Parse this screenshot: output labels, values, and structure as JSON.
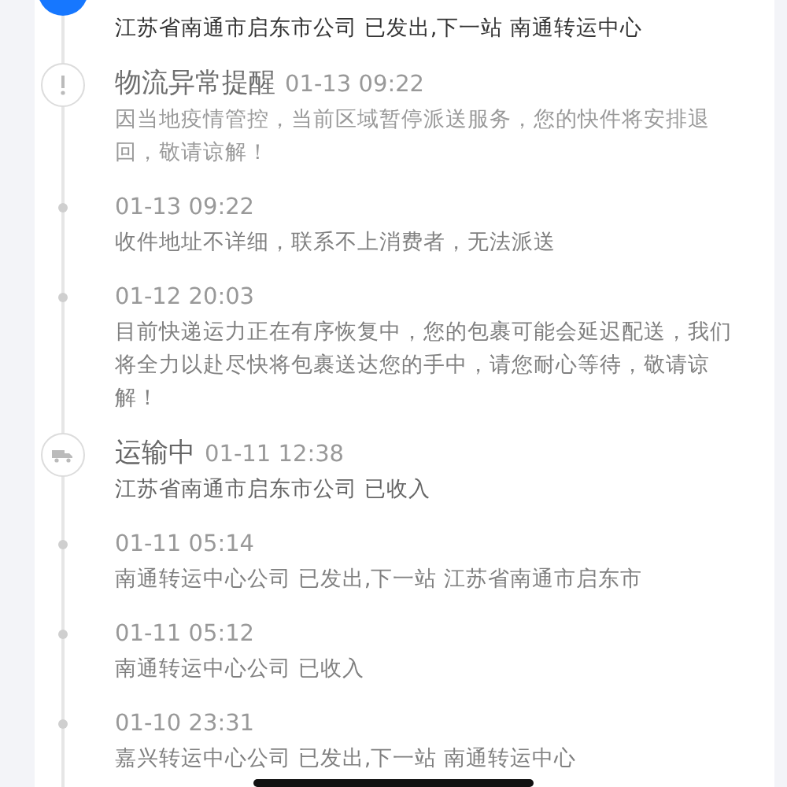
{
  "entries": [
    {
      "kind": "current",
      "body": "江苏省南通市启东市公司 已发出,下一站 南通转运中心"
    },
    {
      "kind": "alert",
      "title": "物流异常提醒",
      "time": "01-13 09:22",
      "body": "因当地疫情管控，当前区域暂停派送服务，您的快件将安排退回，敬请谅解！"
    },
    {
      "kind": "dot",
      "time": "01-13 09:22",
      "body": "收件地址不详细，联系不上消费者，无法派送"
    },
    {
      "kind": "dot",
      "time": "01-12 20:03",
      "body": "目前快递运力正在有序恢复中，您的包裹可能会延迟配送，我们将全力以赴尽快将包裹送达您的手中，请您耐心等待，敬请谅解！"
    },
    {
      "kind": "transit",
      "title": "运输中",
      "time": "01-11 12:38",
      "body": "江苏省南通市启东市公司 已收入"
    },
    {
      "kind": "dot",
      "time": "01-11 05:14",
      "body": "南通转运中心公司 已发出,下一站 江苏省南通市启东市"
    },
    {
      "kind": "dot",
      "time": "01-11 05:12",
      "body": "南通转运中心公司 已收入"
    },
    {
      "kind": "dot",
      "time": "01-10 23:31",
      "body": "嘉兴转运中心公司 已发出,下一站 南通转运中心"
    }
  ]
}
